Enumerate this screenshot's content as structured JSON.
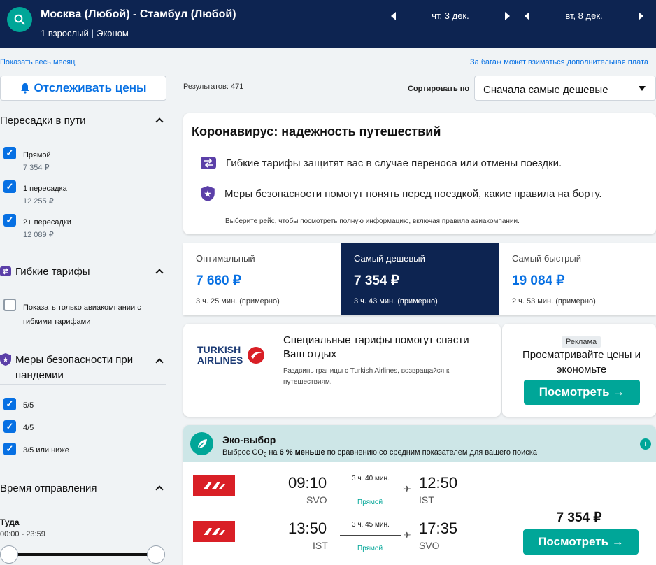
{
  "header": {
    "route": "Москва (Любой) - Стамбул (Любой)",
    "passengers": "1 взрослый",
    "cabin": "Эконом",
    "depart_date": "чт, 3 дек.",
    "return_date": "вт, 8 дек."
  },
  "links": {
    "show_month": "Показать весь месяц",
    "baggage_note": "За багаж может взиматься дополнительная плата"
  },
  "sidebar": {
    "track_label": "Отслеживать цены",
    "stops": {
      "title": "Пересадки в пути",
      "options": [
        {
          "label": "Прямой",
          "price": "7 354 ₽",
          "checked": true
        },
        {
          "label": "1 пересадка",
          "price": "12 255 ₽",
          "checked": true
        },
        {
          "label": "2+ пересадки",
          "price": "12 089 ₽",
          "checked": true
        }
      ]
    },
    "flex": {
      "title": "Гибкие тарифы",
      "option": "Показать только авиакомпании с гибкими тарифами"
    },
    "safety": {
      "title": "Меры безопасности при пандемии",
      "options": [
        "5/5",
        "4/5",
        "3/5 или ниже"
      ]
    },
    "departure": {
      "title": "Время отправления",
      "leg": "Туда",
      "range": "00:00 - 23:59"
    },
    "check_glyph": "✓"
  },
  "results": {
    "count": "Результатов: 471",
    "sort_label": "Сортировать по",
    "sort_value": "Сначала самые дешевые"
  },
  "covid": {
    "title": "Коронавирус: надежность путешествий",
    "row1": "Гибкие тарифы защитят вас в случае переноса или отмены поездки.",
    "row2": "Меры безопасности помогут понять перед поездкой, какие правила на борту.",
    "note": "Выберите рейс, чтобы посмотреть полную информацию, включая правила авиакомпании."
  },
  "tabs": [
    {
      "name": "Оптимальный",
      "price": "7 660 ₽",
      "duration": "3 ч. 25 мин. (примерно)"
    },
    {
      "name": "Самый дешевый",
      "price": "7 354 ₽",
      "duration": "3 ч. 43 мин. (примерно)"
    },
    {
      "name": "Самый быстрый",
      "price": "19 084 ₽",
      "duration": "2 ч. 53 мин. (примерно)"
    }
  ],
  "promo": {
    "logo_line1": "TURKISH",
    "logo_line2": "AIRLINES",
    "title": "Специальные тарифы помогут спасти Ваш отдых",
    "text": "Раздвинь границы с Turkish Airlines, возвращайся к путешествиям.",
    "ad_badge": "Реклама",
    "ad_text": "Просматривайте цены и экономьте",
    "cta": "Посмотреть →"
  },
  "eco": {
    "title": "Эко-выбор",
    "prefix": "Выброс CO",
    "sub2": "2",
    "middle": " на ",
    "bold": "6 % меньше",
    "suffix": " по сравнению со средним показателем для вашего поиска",
    "info": "i"
  },
  "flight": {
    "legs": [
      {
        "dep_time": "09:10",
        "dep_apt": "SVO",
        "duration": "3 ч. 40 мин.",
        "stops": "Прямой",
        "arr_time": "12:50",
        "arr_apt": "IST"
      },
      {
        "dep_time": "13:50",
        "dep_apt": "IST",
        "duration": "3 ч. 45 мин.",
        "stops": "Прямой",
        "arr_time": "17:35",
        "arr_apt": "SVO"
      }
    ],
    "price": "7 354 ₽",
    "cta": "Посмотреть →",
    "plane_glyph": "✈"
  },
  "colors": {
    "navy": "#0d2451",
    "teal": "#00a698",
    "link_blue": "#0770e3",
    "nordwind_red": "#d91f26"
  }
}
